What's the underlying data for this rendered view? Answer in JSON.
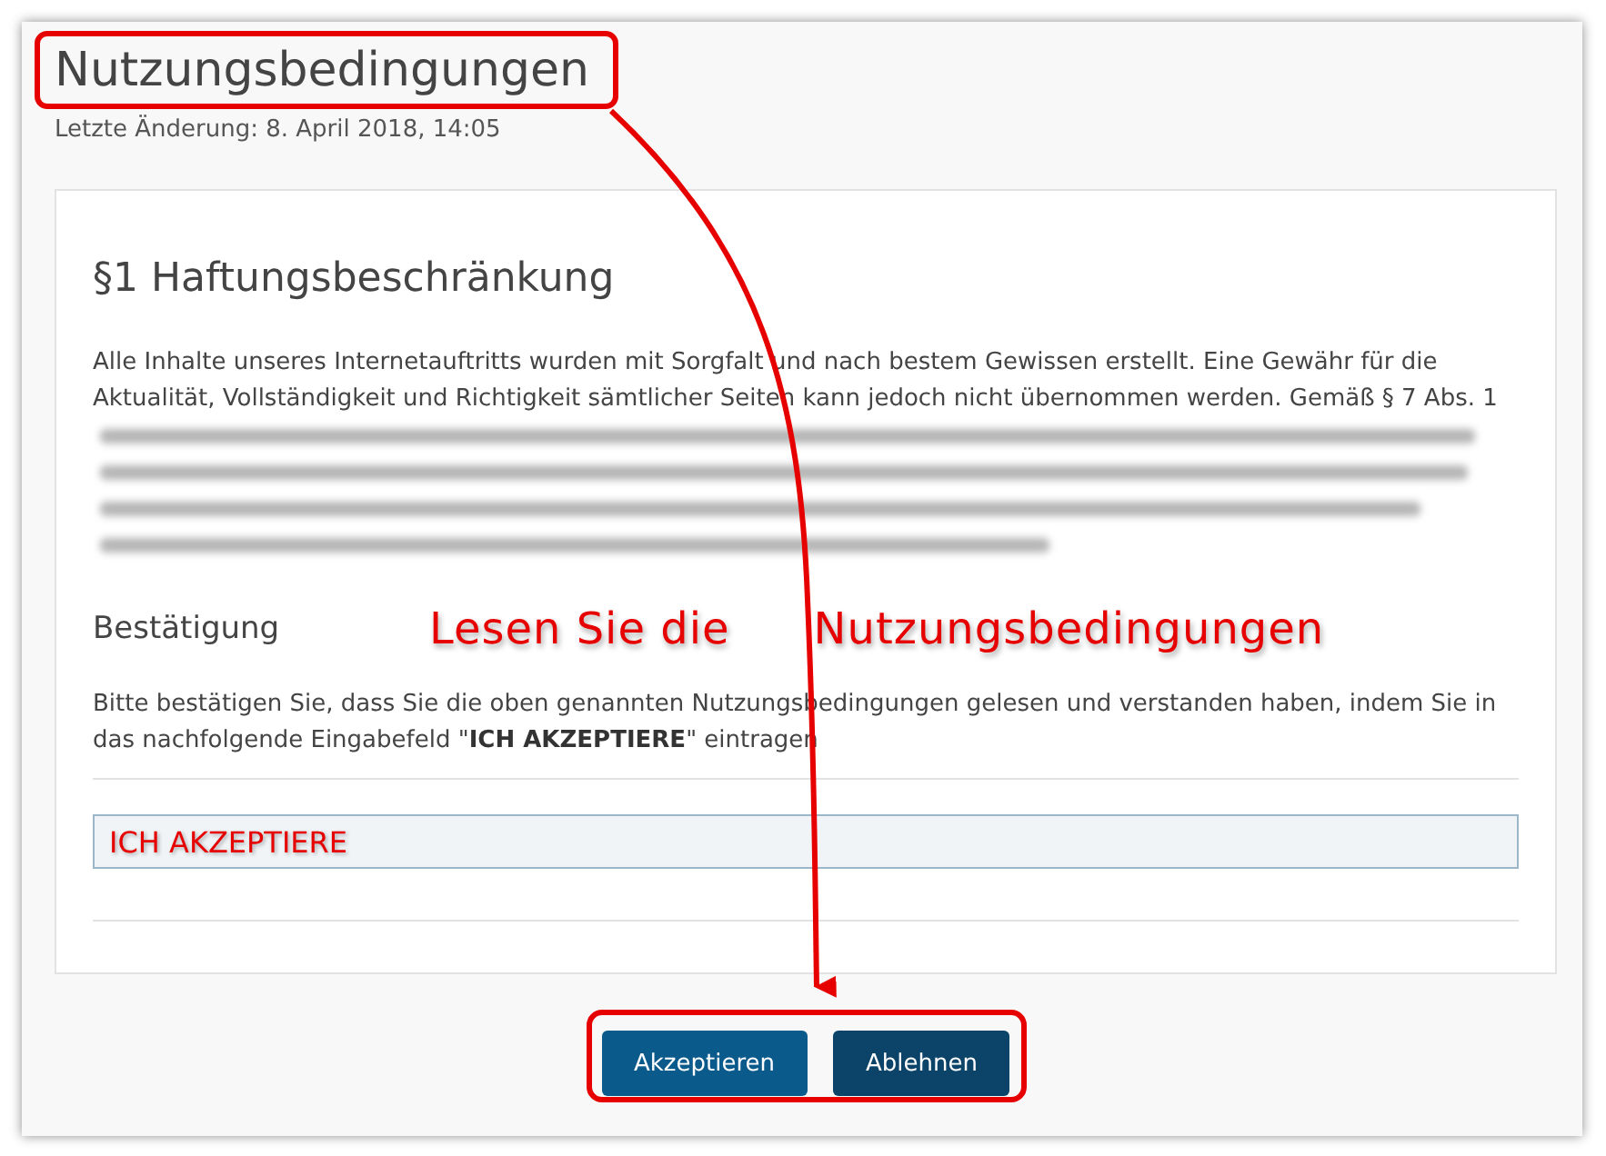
{
  "page": {
    "title": "Nutzungsbedingungen",
    "last_changed": "Letzte Änderung: 8. April 2018, 14:05"
  },
  "section": {
    "heading": "§1 Haftungsbeschränkung",
    "paragraph": "Alle Inhalte unseres Internetauftritts wurden mit Sorgfalt und nach bestem Gewissen erstellt. Eine Gewähr für die Aktualität, Vollständigkeit und Richtigkeit sämtlicher Seiten kann jedoch nicht übernommen werden. Gemäß § 7 Abs. 1"
  },
  "confirmation": {
    "heading": "Bestätigung",
    "text": "Bitte bestätigen Sie, dass Sie die oben genannten Nutzungsbedingungen gelesen und verstanden haben, indem Sie in das nachfolgende Eingabefeld \"**ICH AKZEPTIERE**\" eintragen",
    "input_value": "ICH AKZEPTIERE"
  },
  "buttons": [
    {
      "label": "Akzeptieren",
      "kind": "primary"
    },
    {
      "label": "Ablehnen",
      "kind": "secondary"
    }
  ],
  "annotation_callouts": [
    "Lesen Sie die",
    "Nutzungsbedingungen"
  ]
}
